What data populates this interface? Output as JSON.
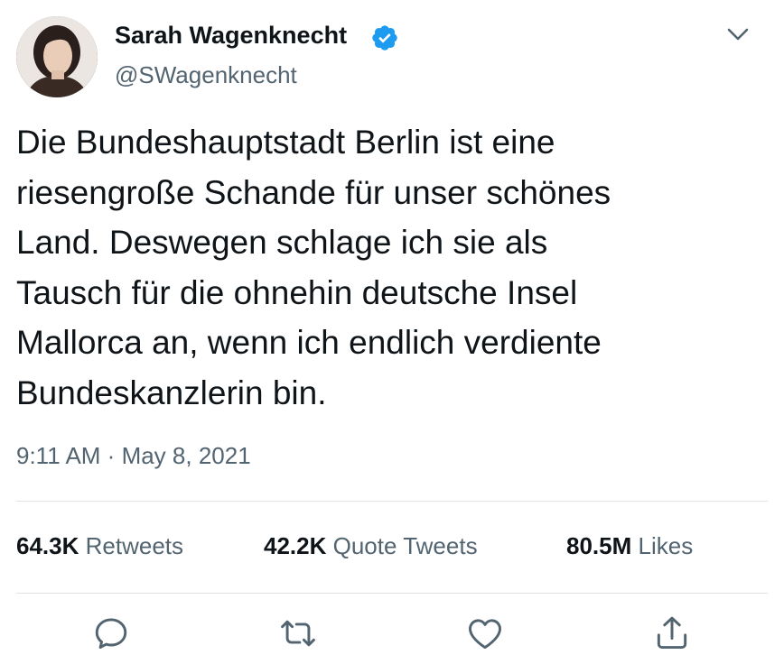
{
  "author": {
    "display_name": "Sarah Wagenknecht",
    "handle": "@SWagenknecht",
    "verified": true,
    "avatar_icon": "profile-photo"
  },
  "tweet": {
    "text": "Die Bundeshauptstadt Berlin ist eine\nriesengroße Schande für unser schönes\nLand. Deswegen schlage ich sie als\nTausch für die ohnehin deutsche Insel\nMallorca an, wenn ich endlich verdiente\nBundeskanzlerin bin.",
    "timestamp": "9:11 AM · May 8, 2021"
  },
  "stats": {
    "retweets": {
      "count": "64.3K",
      "label": "Retweets"
    },
    "quote_tweets": {
      "count": "42.2K",
      "label": "Quote Tweets"
    },
    "likes": {
      "count": "80.5M",
      "label": "Likes"
    }
  },
  "actions": {
    "reply_icon": "reply-icon",
    "retweet_icon": "retweet-icon",
    "like_icon": "heart-icon",
    "share_icon": "share-icon"
  },
  "colors": {
    "text_primary": "#0f1419",
    "text_secondary": "#536471",
    "verified_blue": "#1d9bf0",
    "divider": "#dfe3e6"
  }
}
